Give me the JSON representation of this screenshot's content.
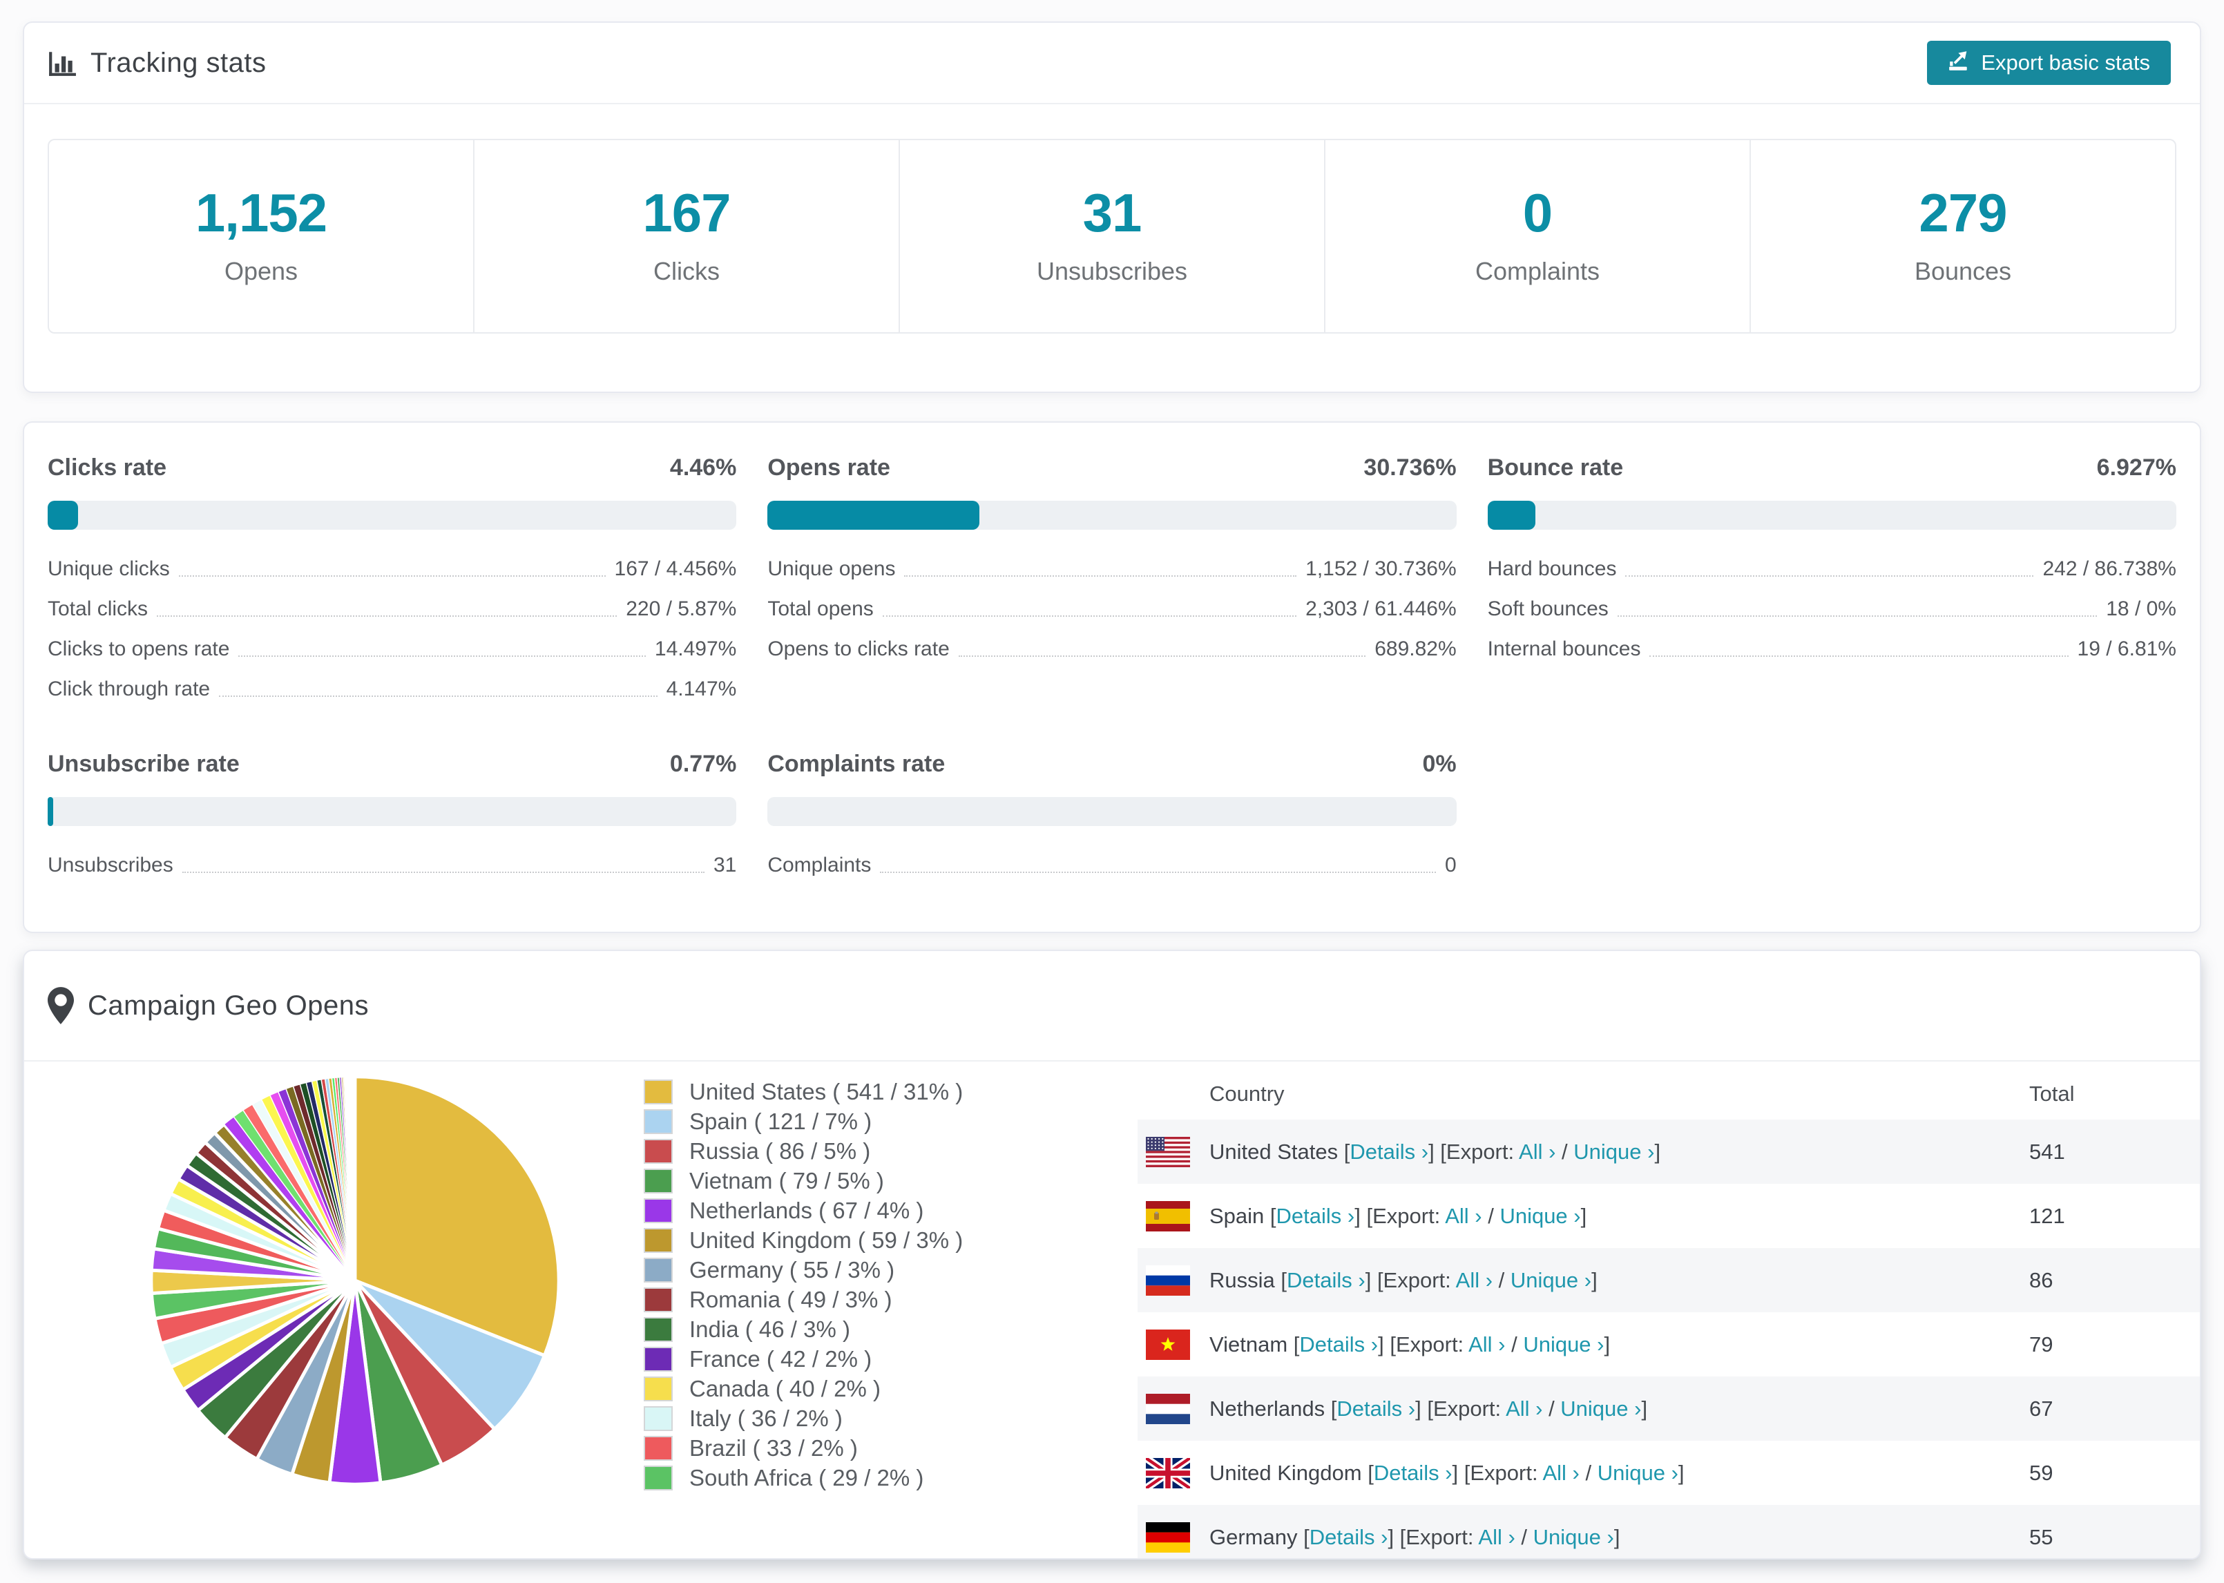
{
  "colors": {
    "accent": "#0c8ea6",
    "button": "#17899d",
    "link": "#1f97ad",
    "bar_fill": "#068ba5",
    "bar_track": "#edf0f3",
    "row_stripe": "#f5f6f8"
  },
  "tracking": {
    "title": "Tracking stats",
    "export_label": "Export basic stats",
    "stats": [
      {
        "value": "1,152",
        "label": "Opens"
      },
      {
        "value": "167",
        "label": "Clicks"
      },
      {
        "value": "31",
        "label": "Unsubscribes"
      },
      {
        "value": "0",
        "label": "Complaints"
      },
      {
        "value": "279",
        "label": "Bounces"
      }
    ]
  },
  "rates": [
    {
      "title": "Clicks rate",
      "value": "4.46%",
      "pct": 4.46,
      "metrics": [
        {
          "label": "Unique clicks",
          "value": "167 / 4.456%"
        },
        {
          "label": "Total clicks",
          "value": "220 / 5.87%"
        },
        {
          "label": "Clicks to opens rate",
          "value": "14.497%"
        },
        {
          "label": "Click through rate",
          "value": "4.147%"
        }
      ]
    },
    {
      "title": "Opens rate",
      "value": "30.736%",
      "pct": 30.736,
      "metrics": [
        {
          "label": "Unique opens",
          "value": "1,152 / 30.736%"
        },
        {
          "label": "Total opens",
          "value": "2,303 / 61.446%"
        },
        {
          "label": "Opens to clicks rate",
          "value": "689.82%"
        }
      ]
    },
    {
      "title": "Bounce rate",
      "value": "6.927%",
      "pct": 6.927,
      "metrics": [
        {
          "label": "Hard bounces",
          "value": "242 / 86.738%"
        },
        {
          "label": "Soft bounces",
          "value": "18 / 0%"
        },
        {
          "label": "Internal bounces",
          "value": "19 / 6.81%"
        }
      ]
    },
    {
      "title": "Unsubscribe rate",
      "value": "0.77%",
      "pct": 0.77,
      "metrics": [
        {
          "label": "Unsubscribes",
          "value": "31"
        }
      ]
    },
    {
      "title": "Complaints rate",
      "value": "0%",
      "pct": 0,
      "metrics": [
        {
          "label": "Complaints",
          "value": "0"
        }
      ]
    }
  ],
  "geo": {
    "title": "Campaign Geo Opens",
    "columns": [
      "Country",
      "Total"
    ],
    "links": {
      "open": "[",
      "close": "]",
      "details": "Details ›",
      "export_prefix": "[Export:",
      "all": "All ›",
      "slash": "/",
      "unique": "Unique ›"
    },
    "rows": [
      {
        "country": "United States",
        "flag": "us",
        "total": "541"
      },
      {
        "country": "Spain",
        "flag": "es",
        "total": "121"
      },
      {
        "country": "Russia",
        "flag": "ru",
        "total": "86"
      },
      {
        "country": "Vietnam",
        "flag": "vn",
        "total": "79"
      },
      {
        "country": "Netherlands",
        "flag": "nl",
        "total": "67"
      },
      {
        "country": "United Kingdom",
        "flag": "gb",
        "total": "59"
      },
      {
        "country": "Germany",
        "flag": "de",
        "total": "55"
      }
    ]
  },
  "chart_data": {
    "type": "pie",
    "title": "Campaign Geo Opens",
    "legend_position": "right",
    "slices": [
      {
        "label": "United States",
        "value": 541,
        "pct": 31,
        "color": "#e3bb3f"
      },
      {
        "label": "Spain",
        "value": 121,
        "pct": 7,
        "color": "#abd3f0"
      },
      {
        "label": "Russia",
        "value": 86,
        "pct": 5,
        "color": "#c94c4e"
      },
      {
        "label": "Vietnam",
        "value": 79,
        "pct": 5,
        "color": "#4b9e4f"
      },
      {
        "label": "Netherlands",
        "value": 67,
        "pct": 4,
        "color": "#9a37e8"
      },
      {
        "label": "United Kingdom",
        "value": 59,
        "pct": 3,
        "color": "#bd982e"
      },
      {
        "label": "Germany",
        "value": 55,
        "pct": 3,
        "color": "#8cabc6"
      },
      {
        "label": "Romania",
        "value": 49,
        "pct": 3,
        "color": "#9c3a3c"
      },
      {
        "label": "India",
        "value": 46,
        "pct": 3,
        "color": "#3b7b3e"
      },
      {
        "label": "France",
        "value": 42,
        "pct": 2,
        "color": "#6d2bb5"
      },
      {
        "label": "Canada",
        "value": 40,
        "pct": 2,
        "color": "#f6de4d"
      },
      {
        "label": "Italy",
        "value": 36,
        "pct": 2,
        "color": "#d9f6f6"
      },
      {
        "label": "Brazil",
        "value": 33,
        "pct": 2,
        "color": "#ee5a5d"
      },
      {
        "label": "South Africa",
        "value": 29,
        "pct": 2,
        "color": "#5bc364"
      }
    ],
    "others": [
      {
        "pct": 1.8,
        "color": "#ecc94b"
      },
      {
        "pct": 1.7,
        "color": "#a64ced"
      },
      {
        "pct": 1.6,
        "color": "#53b85a"
      },
      {
        "pct": 1.5,
        "color": "#f05c5c"
      },
      {
        "pct": 1.4,
        "color": "#d8f7f7"
      },
      {
        "pct": 1.3,
        "color": "#f8ef4e"
      },
      {
        "pct": 1.25,
        "color": "#5f2da8"
      },
      {
        "pct": 1.2,
        "color": "#2f6b33"
      },
      {
        "pct": 1.1,
        "color": "#8e3436"
      },
      {
        "pct": 1.05,
        "color": "#7f98ab"
      },
      {
        "pct": 1.0,
        "color": "#97802a"
      },
      {
        "pct": 0.95,
        "color": "#b13df0"
      },
      {
        "pct": 0.9,
        "color": "#6fe06f"
      },
      {
        "pct": 0.85,
        "color": "#fa6b6b"
      },
      {
        "pct": 0.8,
        "color": "#eefbfb"
      },
      {
        "pct": 0.75,
        "color": "#fcf64f"
      },
      {
        "pct": 0.7,
        "color": "#e64ef0"
      },
      {
        "pct": 0.65,
        "color": "#8b34d6"
      },
      {
        "pct": 0.6,
        "color": "#7a6a22"
      },
      {
        "pct": 0.55,
        "color": "#6e2a2c"
      },
      {
        "pct": 0.5,
        "color": "#1d4f24"
      },
      {
        "pct": 0.45,
        "color": "#232a66"
      },
      {
        "pct": 0.4,
        "color": "#f9f94c"
      },
      {
        "pct": 0.35,
        "color": "#174f38"
      },
      {
        "pct": 0.3,
        "color": "#d4484a"
      },
      {
        "pct": 0.28,
        "color": "#a8d4f2"
      },
      {
        "pct": 0.25,
        "color": "#d9af35"
      },
      {
        "pct": 0.22,
        "color": "#58e96a"
      },
      {
        "pct": 0.2,
        "color": "#f76c6c"
      },
      {
        "pct": 0.18,
        "color": "#3fae4c"
      },
      {
        "pct": 0.15,
        "color": "#7c2fd0"
      },
      {
        "pct": 0.12,
        "color": "#b08c28"
      },
      {
        "pct": 0.1,
        "color": "#e3bb3f"
      },
      {
        "pct": 0.08,
        "color": "#cc4f52"
      },
      {
        "pct": 0.06,
        "color": "#4b9e4f"
      },
      {
        "pct": 0.05,
        "color": "#9a37e8"
      }
    ]
  }
}
